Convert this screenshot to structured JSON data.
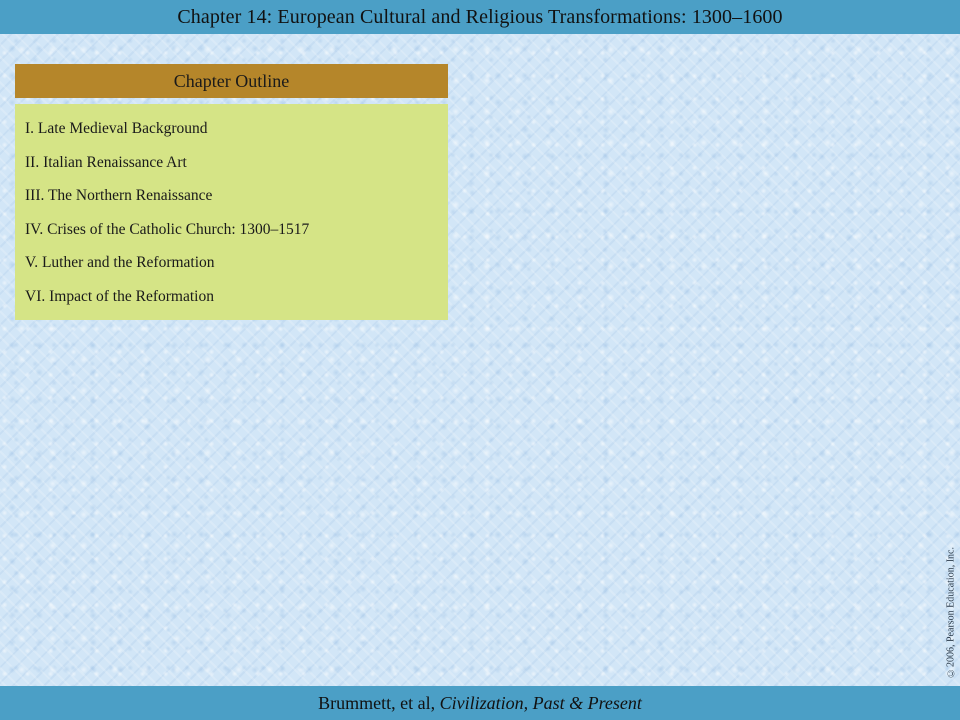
{
  "header": {
    "title": "Chapter 14: European Cultural and Religious Transformations: 1300–1600"
  },
  "outline": {
    "heading": "Chapter Outline",
    "items": [
      "I. Late Medieval Background",
      "II. Italian Renaissance Art",
      "III. The Northern Renaissance",
      "IV. Crises of the Catholic Church: 1300–1517",
      "V. Luther and the Reformation",
      "VI. Impact of the Reformation"
    ]
  },
  "footer": {
    "author": "Brummett, et al, ",
    "book_title": "Civilization, Past & Present"
  },
  "copyright": "©2006, Pearson Education, Inc.",
  "colors": {
    "header_bar": "#4b9fc6",
    "outline_heading": "#b5862a",
    "outline_box": "#d5e486",
    "background": "#d2e6f7"
  }
}
